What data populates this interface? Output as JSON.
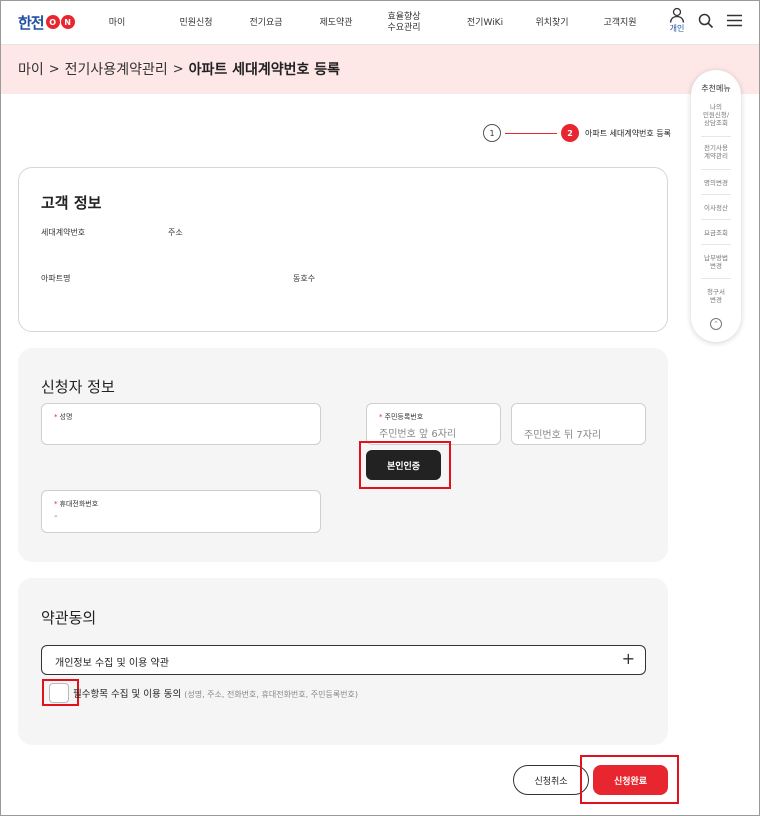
{
  "header": {
    "logo": {
      "text": "한전",
      "on": [
        "O",
        "N"
      ]
    },
    "nav": [
      "마이",
      "민원신청",
      "전기요금",
      "제도약관",
      "효율향상\n수요관리",
      "전기WiKi",
      "위치찾기",
      "고객지원"
    ],
    "user_label": "개인",
    "icons": [
      "user-icon",
      "search-icon",
      "menu-icon"
    ]
  },
  "breadcrumb": {
    "items": [
      "마이",
      "전기사용계약관리"
    ],
    "current": "아파트 세대계약번호 등록",
    "separator": ">"
  },
  "stepper": {
    "step1": "1",
    "step2": "2",
    "step2_label": "아파트 세대계약번호 등록"
  },
  "side_menu": {
    "title": "추천메뉴",
    "items": [
      "나의\n민원신청/\n상담조회",
      "전기사용\n계약관리",
      "명의변경",
      "이사정산",
      "요금조회",
      "납부방법\n변경",
      "청구서\n변경"
    ],
    "top_icon": "chevron-up-icon"
  },
  "customer": {
    "title": "고객 정보",
    "contract_no_label": "세대계약번호",
    "address_label": "주소",
    "apt_name_label": "아파트명",
    "dong_ho_label": "동호수"
  },
  "applicant": {
    "title": "신청자 정보",
    "req_mark": "*",
    "name_label": "성명",
    "rrn_label": "주민등록번호",
    "rrn_front_placeholder": "주민번호 앞 6자리",
    "rrn_back_placeholder": "주민번호 뒤 7자리",
    "verify_button": "본인인증",
    "phone_label": "휴대전화번호",
    "phone_value": "-"
  },
  "terms": {
    "title": "약관동의",
    "privacy_terms": "개인정보 수집 및 이용 약관",
    "expand_icon": "plus-icon",
    "agree_label": "필수항목 수집 및 이용 동의",
    "agree_detail": "(성명, 주소, 전화번호, 휴대전화번호, 주민등록번호)"
  },
  "buttons": {
    "cancel": "신청취소",
    "submit": "신청완료"
  },
  "colors": {
    "accent": "#e8262f",
    "brand": "#1f4fa0",
    "breadcrumb_bg": "#fde7e7",
    "highlight": "#e3101d"
  }
}
